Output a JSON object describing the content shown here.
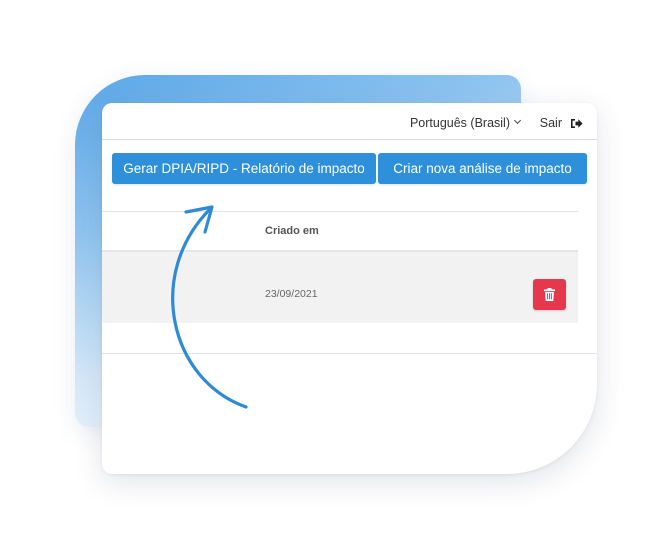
{
  "header": {
    "language_label": "Português (Brasil)",
    "logout_label": "Sair"
  },
  "actions": {
    "generate_report_label": "Gerar DPIA/RIPD - Relatório de impacto",
    "new_analysis_label": "Criar nova análise de impacto"
  },
  "table": {
    "columns": [
      "Criado em"
    ],
    "rows": [
      {
        "created_at": "23/09/2021"
      }
    ]
  },
  "icons": {
    "language_dropdown": "chevron-down-icon",
    "logout": "sign-out-icon",
    "delete": "trash-icon",
    "annotation": "curved-arrow-icon"
  },
  "colors": {
    "primary_button": "#2e8fdb",
    "danger_button": "#e5384f",
    "arrow": "#2d8ad6",
    "gradient_start": "#5aa7e8"
  }
}
